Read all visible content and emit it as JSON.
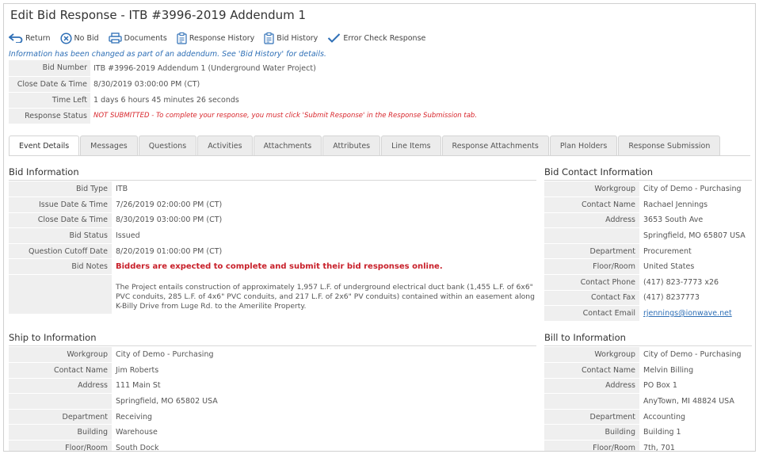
{
  "title": "Edit Bid Response - ITB #3996-2019 Addendum 1",
  "toolbar": {
    "return": "Return",
    "no_bid": "No Bid",
    "documents": "Documents",
    "response_history": "Response History",
    "bid_history": "Bid History",
    "error_check": "Error Check Response"
  },
  "addendum_notice": "Information has been changed as part of an addendum. See 'Bid History' for details.",
  "summary": {
    "bid_number_label": "Bid Number",
    "bid_number": "ITB #3996-2019 Addendum 1 (Underground Water Project)",
    "close_label": "Close Date & Time",
    "close": "8/30/2019 03:00:00 PM (CT)",
    "time_left_label": "Time Left",
    "time_left": "1 days 6 hours 45 minutes 26 seconds",
    "status_label": "Response Status",
    "status": "NOT SUBMITTED - To complete your response, you must click 'Submit Response' in the Response Submission tab."
  },
  "tabs": [
    "Event Details",
    "Messages",
    "Questions",
    "Activities",
    "Attachments",
    "Attributes",
    "Line Items",
    "Response Attachments",
    "Plan Holders",
    "Response Submission"
  ],
  "bid_info": {
    "title": "Bid Information",
    "bid_type_label": "Bid Type",
    "bid_type": "ITB",
    "issue_label": "Issue Date & Time",
    "issue": "7/26/2019 02:00:00 PM (CT)",
    "close_label": "Close Date & Time",
    "close": "8/30/2019 03:00:00 PM (CT)",
    "status_label": "Bid Status",
    "status": "Issued",
    "cutoff_label": "Question Cutoff Date",
    "cutoff": "8/20/2019 01:00:00 PM (CT)",
    "notes_label": "Bid Notes",
    "notes_bold": "Bidders are expected to complete and submit their bid responses online.",
    "notes_text": "The Project entails construction of approximately 1,957 L.F. of underground electrical duct bank (1,455 L.F. of 6x6\" PVC conduits, 285 L.F. of 4x6\" PVC conduits, and 217 L.F. of 2x6\" PV conduits) contained within an easement along K-Billy Drive from Luge Rd. to the Amerilite Property."
  },
  "contact": {
    "title": "Bid Contact Information",
    "workgroup_label": "Workgroup",
    "workgroup": "City of Demo - Purchasing",
    "name_label": "Contact Name",
    "name": "Rachael Jennings",
    "address_label": "Address",
    "address1": "3653 South Ave",
    "address2": "Springfield, MO 65807 USA",
    "dept_label": "Department",
    "dept": "Procurement",
    "floor_label": "Floor/Room",
    "floor": "United States",
    "phone_label": "Contact Phone",
    "phone": "(417) 823-7773 x26",
    "fax_label": "Contact Fax",
    "fax": "(417) 8237773",
    "email_label": "Contact Email",
    "email": "rjennings@ionwave.net"
  },
  "ship_to": {
    "title": "Ship to Information",
    "workgroup_label": "Workgroup",
    "workgroup": "City of Demo - Purchasing",
    "name_label": "Contact Name",
    "name": "Jim Roberts",
    "address_label": "Address",
    "address1": "111 Main St",
    "address2": "Springfield, MO 65802 USA",
    "dept_label": "Department",
    "dept": "Receiving",
    "building_label": "Building",
    "building": "Warehouse",
    "floor_label": "Floor/Room",
    "floor": "South Dock"
  },
  "bill_to": {
    "title": "Bill to Information",
    "workgroup_label": "Workgroup",
    "workgroup": "City of Demo - Purchasing",
    "name_label": "Contact Name",
    "name": "Melvin Billing",
    "address_label": "Address",
    "address1": "PO Box 1",
    "address2": "AnyTown, MI 48824 USA",
    "dept_label": "Department",
    "dept": "Accounting",
    "building_label": "Building",
    "building": "Building 1",
    "floor_label": "Floor/Room",
    "floor": "7th, 701"
  }
}
